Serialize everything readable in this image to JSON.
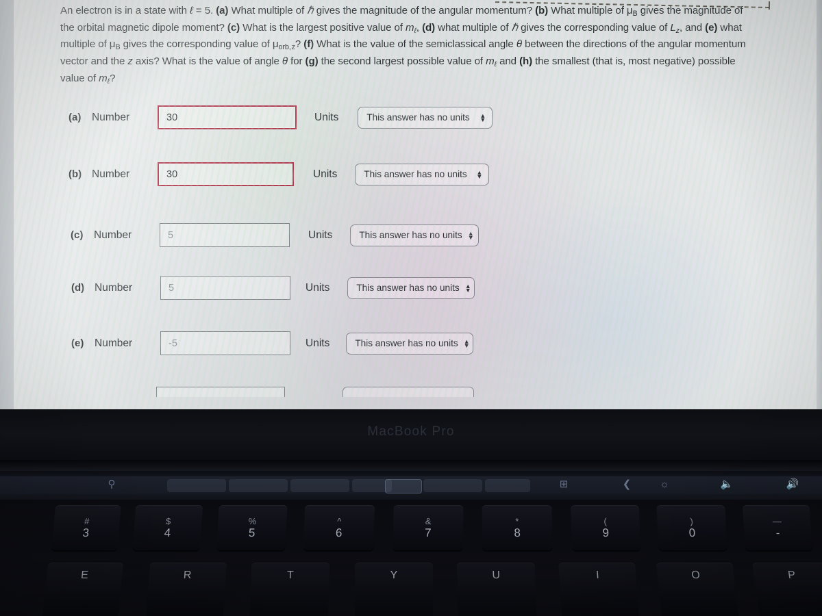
{
  "question": {
    "full_text": "An electron is in a state with ℓ = 5. (a) What multiple of ℏ gives the magnitude of the angular momentum? (b) What multiple of μB gives the magnitude of the orbital magnetic dipole moment? (c) What is the largest positive value of mℓ, (d) what multiple of ℏ gives the corresponding value of Lz, and (e) what multiple of μB gives the corresponding value of μorb,z? (f) What is the value of the semiclassical angle θ between the directions of the angular momentum vector and the z axis? What is the value of angle θ for (g) the second largest possible value of mℓ and (h) the smallest (that is, most negative) possible value of mℓ?",
    "lines": [
      "An electron is in a state with ℓ = 5. (a) What multiple of ℏ gives the magnitude of the angular momentum? (b) What multiple of μB gives",
      "the magnitude of the orbital magnetic dipole moment? (c) What is the largest positive value of mℓ, (d) what multiple of ℏ gives the",
      "corresponding value of Lz, and (e) what multiple of μB gives the corresponding value of μorb,z? (f) What is the value of the semiclassical",
      "angle θ between the directions of the angular momentum vector and the z axis? What is the value of angle θ for (g) the second largest",
      "possible value of mℓ and (h) the smallest (that is, most negative) possible value of mℓ?"
    ]
  },
  "answers": {
    "number_label": "Number",
    "units_label": "Units",
    "units_option_selected": "This answer has no units",
    "spinner_up": "▲",
    "spinner_down": "▼",
    "rows": [
      {
        "part": "(a)",
        "value": "30",
        "state": "error",
        "units": "This answer has no units"
      },
      {
        "part": "(b)",
        "value": "30",
        "state": "error",
        "units": "This answer has no units"
      },
      {
        "part": "(c)",
        "value": "5",
        "state": "normal",
        "units": "This answer has no units"
      },
      {
        "part": "(d)",
        "value": "5",
        "state": "normal",
        "units": "This answer has no units"
      },
      {
        "part": "(e)",
        "value": "-5",
        "state": "normal",
        "units": "This answer has no units"
      }
    ]
  },
  "colors": {
    "error_border": "#b1344c",
    "input_border": "#7c8186",
    "text": "#2e3236",
    "screen_background": "#d2d5d9"
  },
  "laptop": {
    "bezel_label": "MacBook Pro",
    "touchbar": {
      "search_icon": "search-icon",
      "suggestions": [
        "",
        "",
        "",
        "",
        ""
      ],
      "right_icons": [
        "new-tab-icon",
        "back-chevron-icon",
        "brightness-icon",
        "volume-down-icon",
        "volume-up-icon"
      ]
    },
    "keyboard": {
      "number_row": [
        {
          "upper": "#",
          "lower": "3"
        },
        {
          "upper": "$",
          "lower": "4"
        },
        {
          "upper": "%",
          "lower": "5"
        },
        {
          "upper": "^",
          "lower": "6"
        },
        {
          "upper": "&",
          "lower": "7"
        },
        {
          "upper": "*",
          "lower": "8"
        },
        {
          "upper": "(",
          "lower": "9"
        },
        {
          "upper": ")",
          "lower": "0"
        },
        {
          "upper": "—",
          "lower": "-"
        }
      ],
      "letter_row": [
        {
          "lower": "E"
        },
        {
          "lower": "R"
        },
        {
          "lower": "T"
        },
        {
          "lower": "Y"
        },
        {
          "lower": "U"
        },
        {
          "lower": "I"
        },
        {
          "lower": "O"
        },
        {
          "lower": "P"
        }
      ]
    }
  }
}
